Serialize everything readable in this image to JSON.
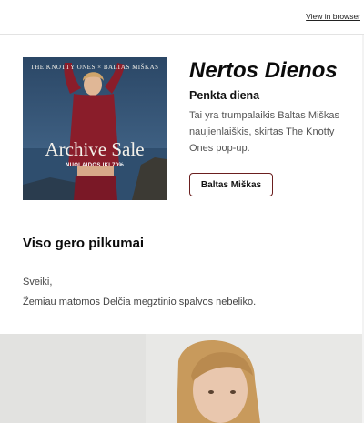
{
  "header": {
    "view_in_browser": "View in browser"
  },
  "hero": {
    "brand_left": "THE KNOTTY ONES",
    "brand_sep": "×",
    "brand_right": "BALTAS MIŠKAS",
    "sale_title": "Archive Sale",
    "discount": "NUOLAIDOS IKI 70%"
  },
  "intro": {
    "title": "Nertos Dienos",
    "subtitle": "Penkta diena",
    "description": "Tai yra trumpalaikis Baltas Miškas naujienlaiškis, skirtas The Knotty Ones pop-up.",
    "cta_label": "Baltas Miškas"
  },
  "message": {
    "heading": "Viso gero pilkumai",
    "greeting": "Sveiki,",
    "body": "Žemiau matomos Delčia megztinio spalvos nebeliko."
  },
  "colors": {
    "cta_border": "#6b1f1f",
    "sweater": "#8a1d2a",
    "sky": "#27415e"
  }
}
